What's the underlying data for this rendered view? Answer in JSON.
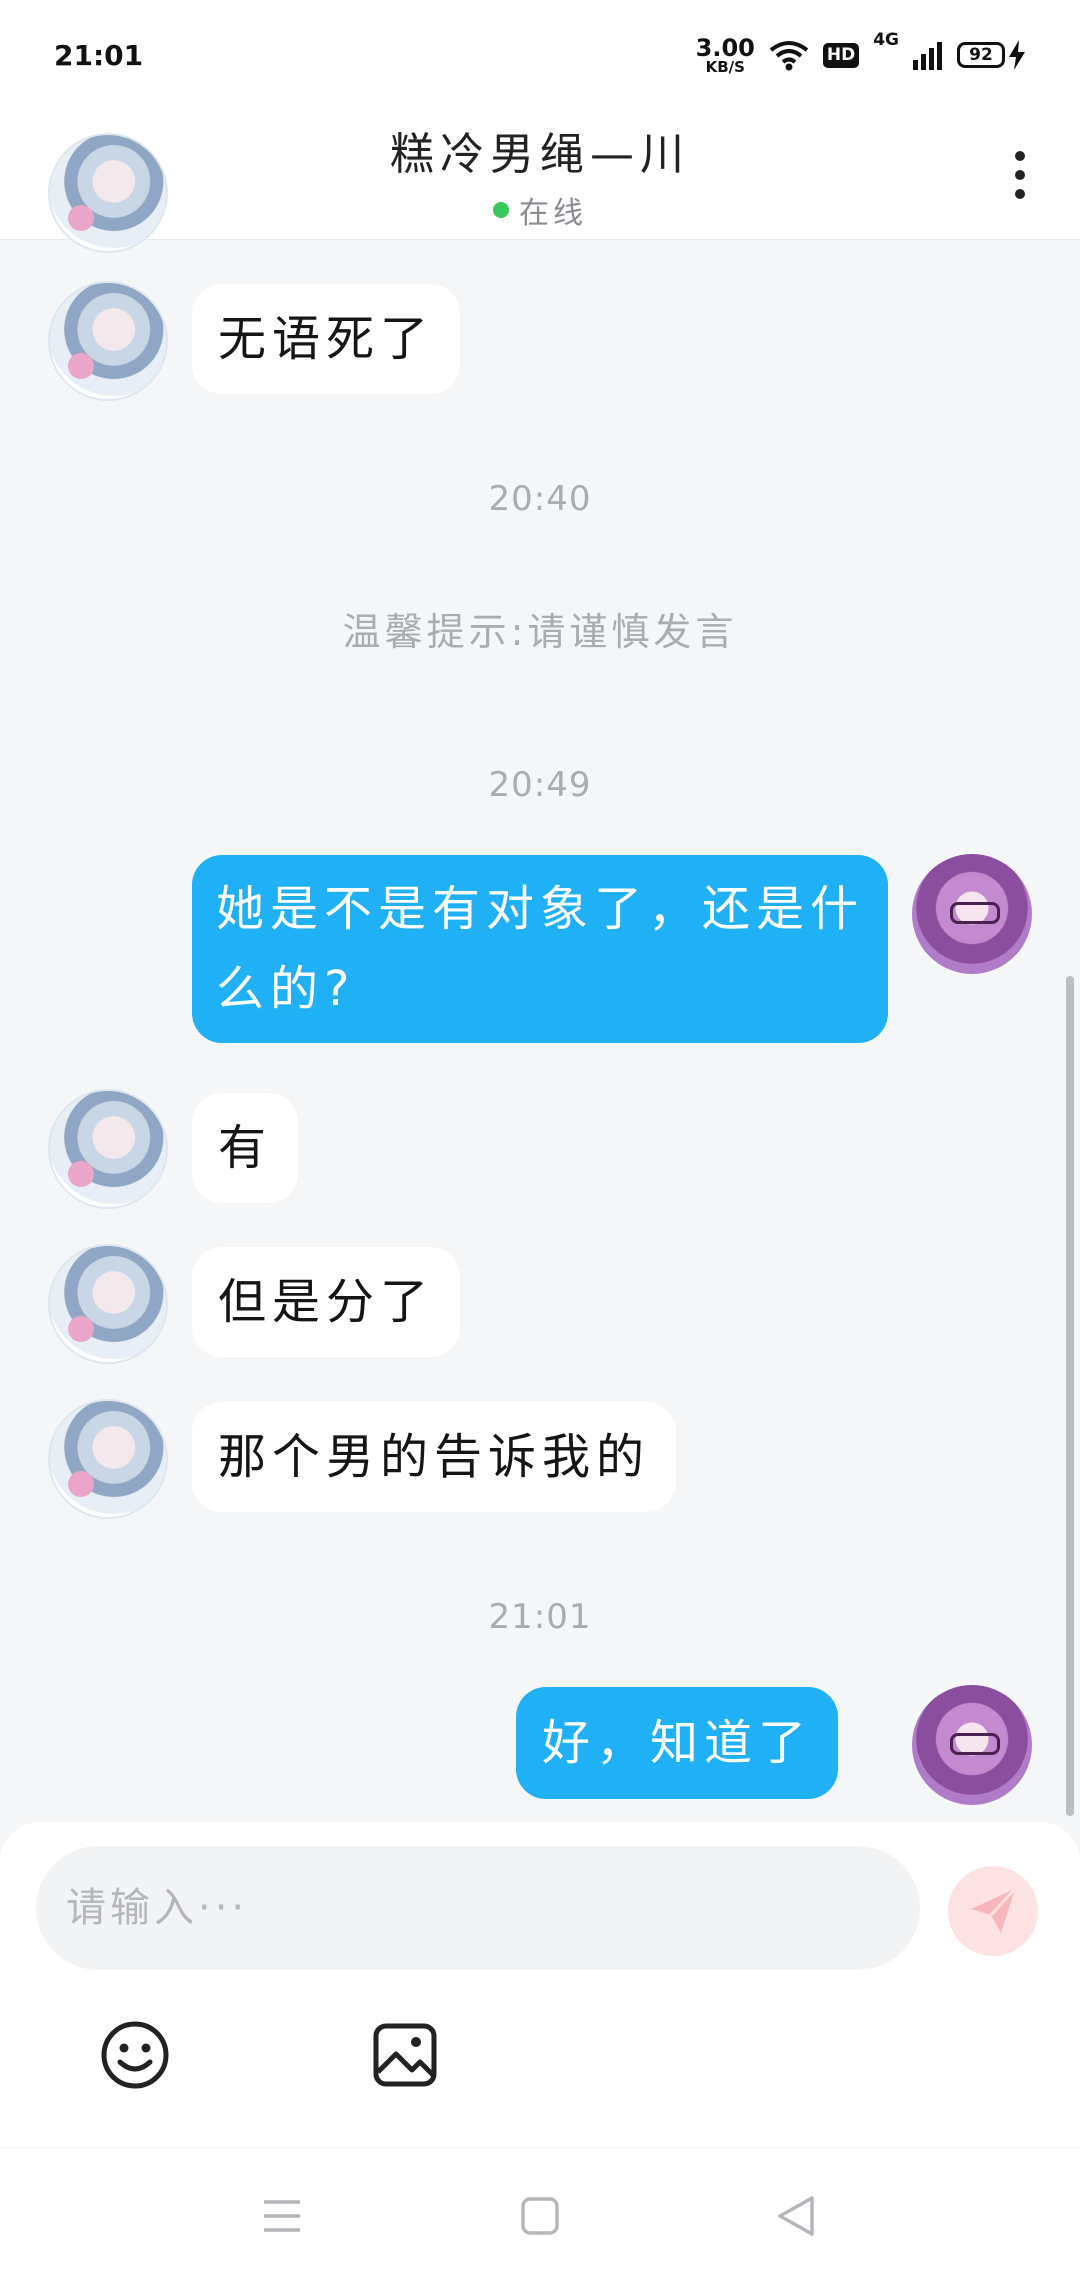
{
  "status_bar": {
    "time": "21:01",
    "net_speed_value": "3.00",
    "net_speed_unit": "KB/S",
    "hd_label": "HD",
    "network_type": "4G",
    "battery_level": "92"
  },
  "header": {
    "title": "糕冷男绳—川",
    "status": "在线",
    "status_color": "#38c75a"
  },
  "messages": [
    {
      "type": "in",
      "text": "无语死了"
    },
    {
      "type": "time",
      "text": "20:40"
    },
    {
      "type": "tip",
      "text": "温馨提示:请谨慎发言"
    },
    {
      "type": "time",
      "text": "20:49"
    },
    {
      "type": "out",
      "text": "她是不是有对象了，还是什么的?"
    },
    {
      "type": "in",
      "text": "有"
    },
    {
      "type": "in",
      "text": "但是分了"
    },
    {
      "type": "in",
      "text": "那个男的告诉我的"
    },
    {
      "type": "time",
      "text": "21:01"
    },
    {
      "type": "out",
      "text": "好，知道了"
    }
  ],
  "input": {
    "placeholder": "请输入···",
    "value": ""
  },
  "colors": {
    "outgoing_bubble": "#1fb0f5",
    "incoming_bubble": "#ffffff",
    "background": "#f4f6f8",
    "send_button": "#fde2e3"
  },
  "icons": [
    "back-icon",
    "more-icon",
    "send-icon",
    "emoji-icon",
    "image-icon",
    "menu-icon",
    "home-icon",
    "back-nav-icon"
  ]
}
